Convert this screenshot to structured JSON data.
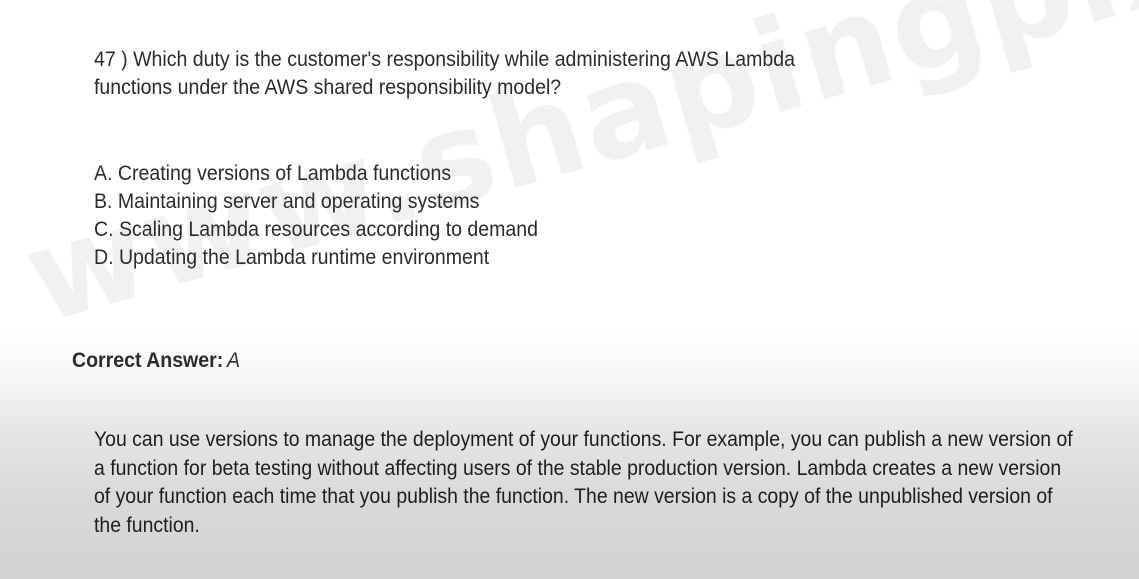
{
  "watermark": "www.shapingpixel.com",
  "question": {
    "text": "47 ) Which duty is the customer's responsibility while administering AWS Lambda functions under the AWS shared responsibility model?"
  },
  "options": [
    {
      "text": "A. Creating versions of Lambda functions"
    },
    {
      "text": "B. Maintaining server and operating systems"
    },
    {
      "text": "C. Scaling Lambda resources according to demand"
    },
    {
      "text": "D. Updating the Lambda runtime environment"
    }
  ],
  "answer": {
    "label": "Correct Answer:",
    "value": "A"
  },
  "explanation": "You can use versions to manage the deployment of your functions. For example, you can publish a new version of a function for beta testing without affecting users of the stable production version. Lambda creates a new version of your function each time that you publish the function. The new version is a copy of the unpublished version of the function."
}
